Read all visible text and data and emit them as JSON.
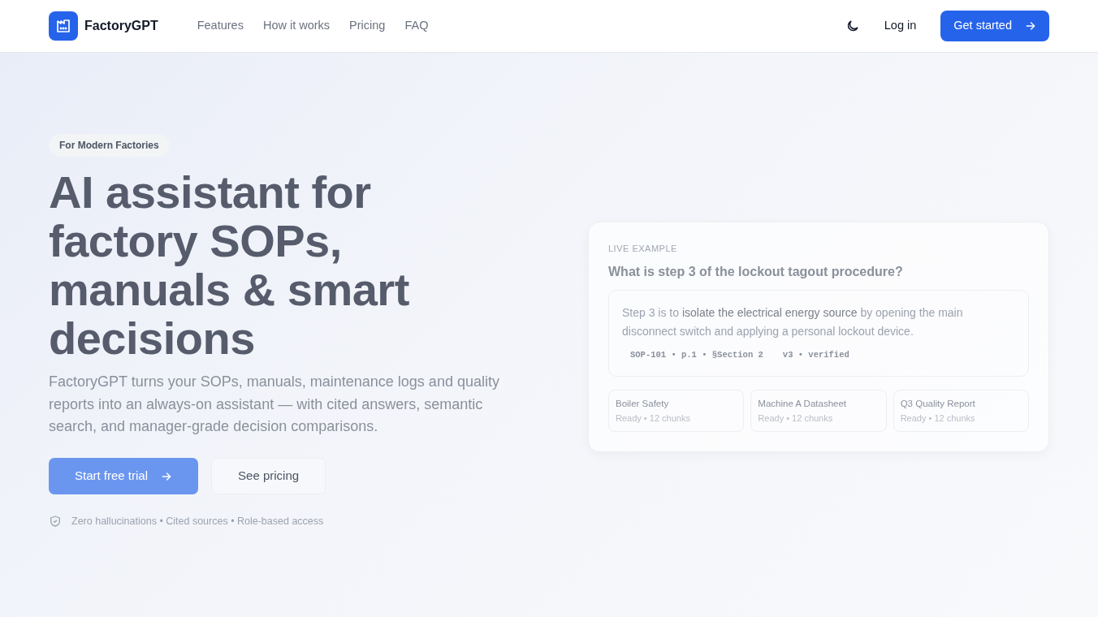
{
  "brand": {
    "name": "FactoryGPT"
  },
  "nav": [
    {
      "label": "Features"
    },
    {
      "label": "How it works"
    },
    {
      "label": "Pricing"
    },
    {
      "label": "FAQ"
    }
  ],
  "header_actions": {
    "login": "Log in",
    "cta": "Get started"
  },
  "hero": {
    "badge": "For Modern Factories",
    "title": "AI assistant for factory SOPs, manuals & smart decisions",
    "lead": "FactoryGPT turns your SOPs, manuals, maintenance logs and quality reports into an always-on assistant — with cited answers, semantic search, and manager-grade decision comparisons.",
    "primary": "Start free trial",
    "secondary": "See pricing",
    "trust": "Zero hallucinations • Cited sources • Role-based access"
  },
  "example": {
    "eyebrow": "LIVE EXAMPLE",
    "question": "What is step 3 of the lockout tagout procedure?",
    "answer": "Step 3 is to **isolate the electrical energy source** by opening the main disconnect switch and applying a personal lockout device.",
    "citations": [
      "SOP-101 • p.1 • §Section 2",
      "v3 • verified"
    ],
    "documents": [
      {
        "name": "Boiler Safety",
        "status": "Ready • 12 chunks"
      },
      {
        "name": "Machine A Datasheet",
        "status": "Ready • 12 chunks"
      },
      {
        "name": "Q3 Quality Report",
        "status": "Ready • 12 chunks"
      }
    ]
  }
}
